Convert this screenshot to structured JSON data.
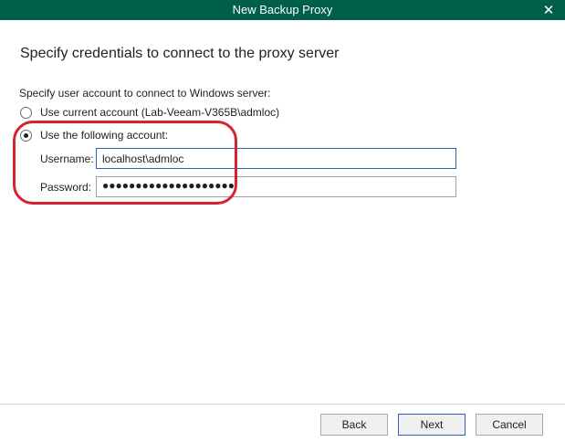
{
  "window": {
    "title": "New Backup Proxy",
    "close_glyph": "✕"
  },
  "page": {
    "heading": "Specify credentials to connect to the proxy server",
    "prompt": "Specify user account to connect to Windows server:"
  },
  "options": {
    "current_account": {
      "label": "Use current account (Lab-Veeam-V365B\\admloc)",
      "selected": false
    },
    "following_account": {
      "label": "Use the following account:",
      "selected": true
    }
  },
  "fields": {
    "username_label": "Username:",
    "username_value": "localhost\\admloc",
    "password_label": "Password:",
    "password_value": "●●●●●●●●●●●●●●●●●●●●"
  },
  "annotation": {
    "shape": "rounded-rectangle",
    "color": "#d8232f"
  },
  "buttons": {
    "back": "Back",
    "next": "Next",
    "cancel": "Cancel"
  },
  "colors": {
    "titlebar": "#005f4b",
    "focus_border": "#2a62b7"
  },
  "icons": {
    "close": "close-icon"
  }
}
